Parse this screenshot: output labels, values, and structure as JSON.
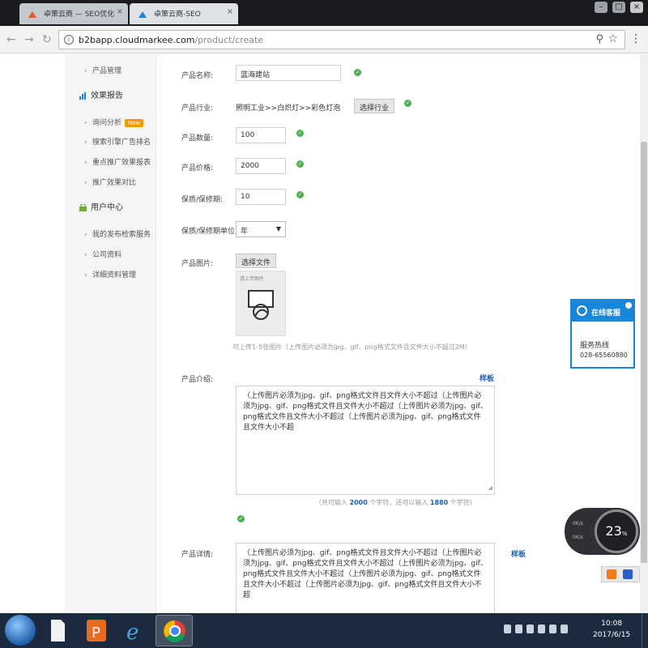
{
  "browser": {
    "tabs": [
      {
        "title": "卓策云商 — SEO优化",
        "active": false
      },
      {
        "title": "卓策云商-SEO",
        "active": true
      }
    ],
    "url_host": "b2bapp.cloudmarkee.com",
    "url_path": "/product/create"
  },
  "sidebar": {
    "top_item": "产品管理",
    "sections": [
      {
        "title": "效果报告",
        "items": [
          "询问分析",
          "搜索引擎广告排名",
          "重点推广效果报表",
          "推广效果对比"
        ],
        "badge": "New"
      },
      {
        "title": "用户中心",
        "items": [
          "我的发布检索服务",
          "公司资料",
          "详细资料管理"
        ]
      }
    ]
  },
  "form": {
    "name": {
      "label": "产品名称:",
      "value": "蓝海建站"
    },
    "industry": {
      "label": "产品行业:",
      "value": "照明工业>>白炽灯>>彩色灯泡",
      "button": "选择行业"
    },
    "quantity": {
      "label": "产品数量:",
      "value": "100"
    },
    "price": {
      "label": "产品价格:",
      "value": "2000"
    },
    "warranty": {
      "label": "保质/保修期:",
      "value": "10"
    },
    "warranty_unit": {
      "label": "保质/保修期单位:",
      "value": "年"
    },
    "image": {
      "label": "产品图片:",
      "button": "选择文件",
      "preview_text": "请上传图片",
      "hint": "可上传1-5张图片（上传图片必须为jpg、gif、png格式文件且文件大小不超过2M）"
    },
    "intro": {
      "label": "产品介绍:",
      "sample": "样板",
      "text": "（上传图片必须为jpg、gif、png格式文件且文件大小不超过（上传图片必须为jpg、gif、png格式文件且文件大小不超过（上传图片必须为jpg、gif、png格式文件且文件大小不超过（上传图片必须为jpg、gif、png格式文件且文件大小不超",
      "counter_prefix": "（共可输入",
      "counter_max": "2000",
      "counter_mid": "个字符，还可以输入",
      "counter_left": "1880",
      "counter_suffix": "个字符）"
    },
    "detail": {
      "label": "产品详情:",
      "sample": "样板",
      "text": "（上传图片必须为jpg、gif、png格式文件且文件大小不超过（上传图片必须为jpg、gif、png格式文件且文件大小不超过（上传图片必须为jpg、gif、png格式文件且文件大小不超过（上传图片必须为jpg、gif、png格式文件且文件大小不超过（上传图片必须为jpg、gif、png格式文件且文件大小不超"
    }
  },
  "service": {
    "title": "在线客服",
    "hotline_label": "服务热线",
    "phone": "028-65560880"
  },
  "speed": {
    "percent": "23",
    "unit": "%",
    "up": "0K/s",
    "down": "0K/s"
  },
  "taskbar": {
    "time": "10:08",
    "date": "2017/6/15"
  },
  "colors": {
    "accent": "#1a86d8",
    "ok": "#4caf50",
    "badge": "#f39800",
    "taskbar": "#1b2a3e"
  }
}
